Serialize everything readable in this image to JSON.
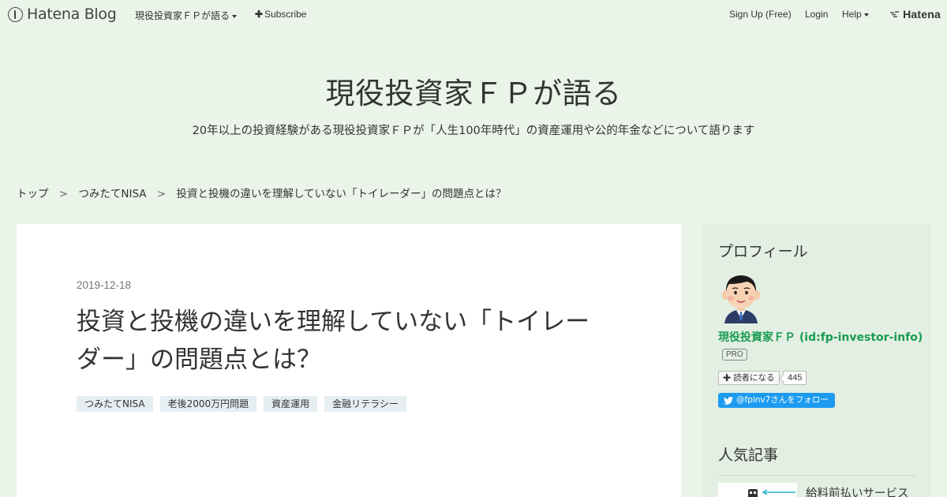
{
  "global_header": {
    "logo_text": "Hatena Blog",
    "blog_menu_label": "現役投資家ＦＰが語る",
    "subscribe_label": "Subscribe",
    "signup_label": "Sign Up (Free)",
    "login_label": "Login",
    "help_label": "Help",
    "hatena_label": "Hatena"
  },
  "blog": {
    "title": "現役投資家ＦＰが語る",
    "description": "20年以上の投資経験がある現役投資家ＦＰが「人生100年時代」の資産運用や公的年金などについて語ります"
  },
  "breadcrumb": {
    "items": [
      "トップ",
      "つみたてNISA",
      "投資と投機の違いを理解していない「トイレーダー」の問題点とは？"
    ],
    "separator": ">"
  },
  "article": {
    "date": "2019-12-18",
    "title_line1": "投資と投機の違いを理解していない「トイレー",
    "title_line2": "ダー」の問題点とは？",
    "tags": [
      "つみたてNISA",
      "老後2000万円問題",
      "資産運用",
      "金融リテラシー"
    ]
  },
  "sidebar": {
    "profile_heading": "プロフィール",
    "profile_name": "現役投資家ＦＰ (id:fp-investor-info)",
    "pro_badge": "PRO",
    "subscribe_label": "読者になる",
    "subscriber_count": "445",
    "twitter_label": "@fpinv7さんをフォロー",
    "popular_heading": "人気記事",
    "popular_first_title": "給料前払いサービス"
  },
  "colors": {
    "page_bg": "#eaf4e9",
    "sidebar_bg": "#e3efe2",
    "profile_link": "#1a9c52",
    "twitter": "#1d9bf0",
    "tag_bg": "#e6eef2"
  }
}
